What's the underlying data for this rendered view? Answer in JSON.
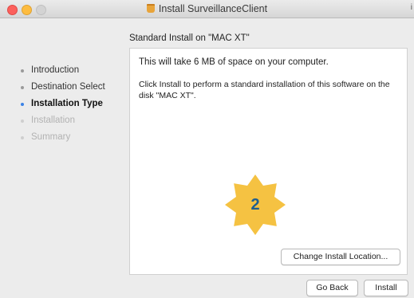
{
  "window": {
    "title": "Install SurveillanceClient",
    "corner_text": "i"
  },
  "subtitle": "Standard Install on \"MAC XT\"",
  "sidebar": {
    "items": [
      {
        "label": "Introduction",
        "state": "done"
      },
      {
        "label": "Destination Select",
        "state": "done"
      },
      {
        "label": "Installation Type",
        "state": "active"
      },
      {
        "label": "Installation",
        "state": "pending"
      },
      {
        "label": "Summary",
        "state": "pending"
      }
    ]
  },
  "content": {
    "space_text": "This will take 6 MB of space on your computer.",
    "instructions": "Click Install to perform a standard installation of this software on the disk \"MAC XT\"."
  },
  "badge": {
    "number": "2",
    "color": "#f5c242"
  },
  "buttons": {
    "change_location": "Change Install Location...",
    "go_back": "Go Back",
    "install": "Install"
  }
}
